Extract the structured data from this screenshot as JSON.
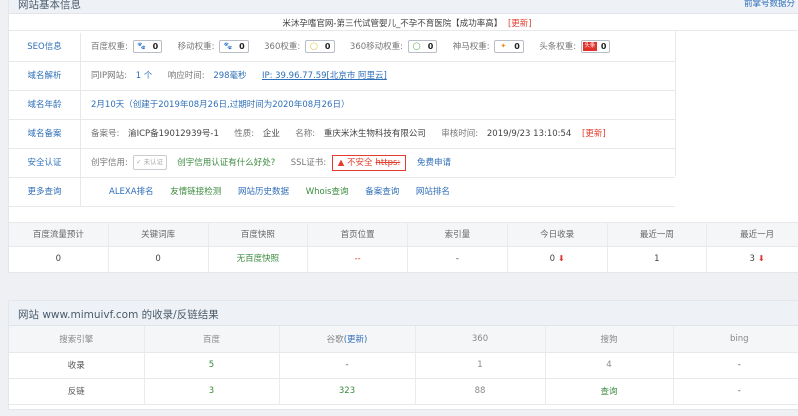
{
  "panel1": {
    "title": "网站基本信息",
    "head_link": "前掌号数据分",
    "site_title": "米沐孕嗜官网-第三代试管婴儿_不孕不育医院【成功率高】",
    "update": "[更新]",
    "seo": {
      "label": "SEO信息",
      "items": [
        {
          "name": "百度权重:",
          "icon": "paw-icon",
          "icon_text": "🐾",
          "icon_color": "#2c5fc4",
          "value": "0"
        },
        {
          "name": "移动权重:",
          "icon": "paw-icon",
          "icon_text": "🐾",
          "icon_color": "#2c5fc4",
          "value": "0"
        },
        {
          "name": "360权重:",
          "icon": "ring-icon",
          "icon_text": "◯",
          "icon_color": "#e0b21a",
          "value": "0"
        },
        {
          "name": "360移动权重:",
          "icon": "ring-icon",
          "icon_text": "◯",
          "icon_color": "#3a9a3a",
          "value": "0"
        },
        {
          "name": "神马权重:",
          "icon": "horse-icon",
          "icon_text": "✦",
          "icon_color": "#f08a1c",
          "value": "0"
        },
        {
          "name": "头条权重:",
          "icon": "toutiao-icon",
          "icon_text": "头条",
          "icon_color": "#e0322a",
          "value": "0"
        }
      ]
    },
    "domain_resolve": {
      "label": "域名解析",
      "same_ip_label": "同IP网站:",
      "same_ip_value": "1 个",
      "resp_label": "响应时间:",
      "resp_value": "298毫秒",
      "ip_text": "IP: 39.96.77.59[北京市 阿里云]"
    },
    "domain_age": {
      "label": "域名年龄",
      "value": "2月10天（创建于2019年08月26日,过期时间为2020年08月26日）"
    },
    "domain_record": {
      "label": "域名备案",
      "record_no_label": "备案号:",
      "record_no": "渝ICP备19012939号-1",
      "nature_label": "性质:",
      "nature": "企业",
      "name_label": "名称:",
      "name": "重庆米沐生物科技有限公司",
      "audit_label": "审核时间:",
      "audit": "2019/9/23 13:10:54",
      "update": "[更新]"
    },
    "security": {
      "label": "安全认证",
      "credit_label": "创宇信用:",
      "credit_badge": "未认证",
      "credit_link": "创宇信用认证有什么好处?",
      "ssl_label": "SSL证书:",
      "ssl_warn": "▲ 不安全",
      "ssl_https": "https:",
      "free_apply": "免费申请"
    },
    "more": {
      "label": "更多查询",
      "links": [
        "ALEXA排名",
        "友情链接检测",
        "网站历史数据",
        "Whois查询",
        "备案查询",
        "网站排名"
      ]
    }
  },
  "stats": {
    "headers": [
      "百度流量预计",
      "关键词库",
      "百度快照",
      "首页位置",
      "索引量",
      "今日收录",
      "最近一周",
      "最近一月"
    ],
    "values": [
      "0",
      "0",
      "无百度快照",
      "--",
      "-",
      "0",
      "1",
      "3"
    ]
  },
  "panel2": {
    "title": "网站 www.mimuivf.com 的收录/反链结果",
    "headers": [
      "搜索引擎",
      "百度",
      "谷歌",
      "(更新)",
      "360",
      "搜狗",
      "bing"
    ],
    "rows": [
      {
        "name": "收录",
        "baidu": "5",
        "google": "-",
        "s360": "1",
        "sogou": "4",
        "bing": "-"
      },
      {
        "name": "反链",
        "baidu": "3",
        "google": "323",
        "s360": "88",
        "sogou": "查询",
        "bing": "-"
      }
    ]
  }
}
